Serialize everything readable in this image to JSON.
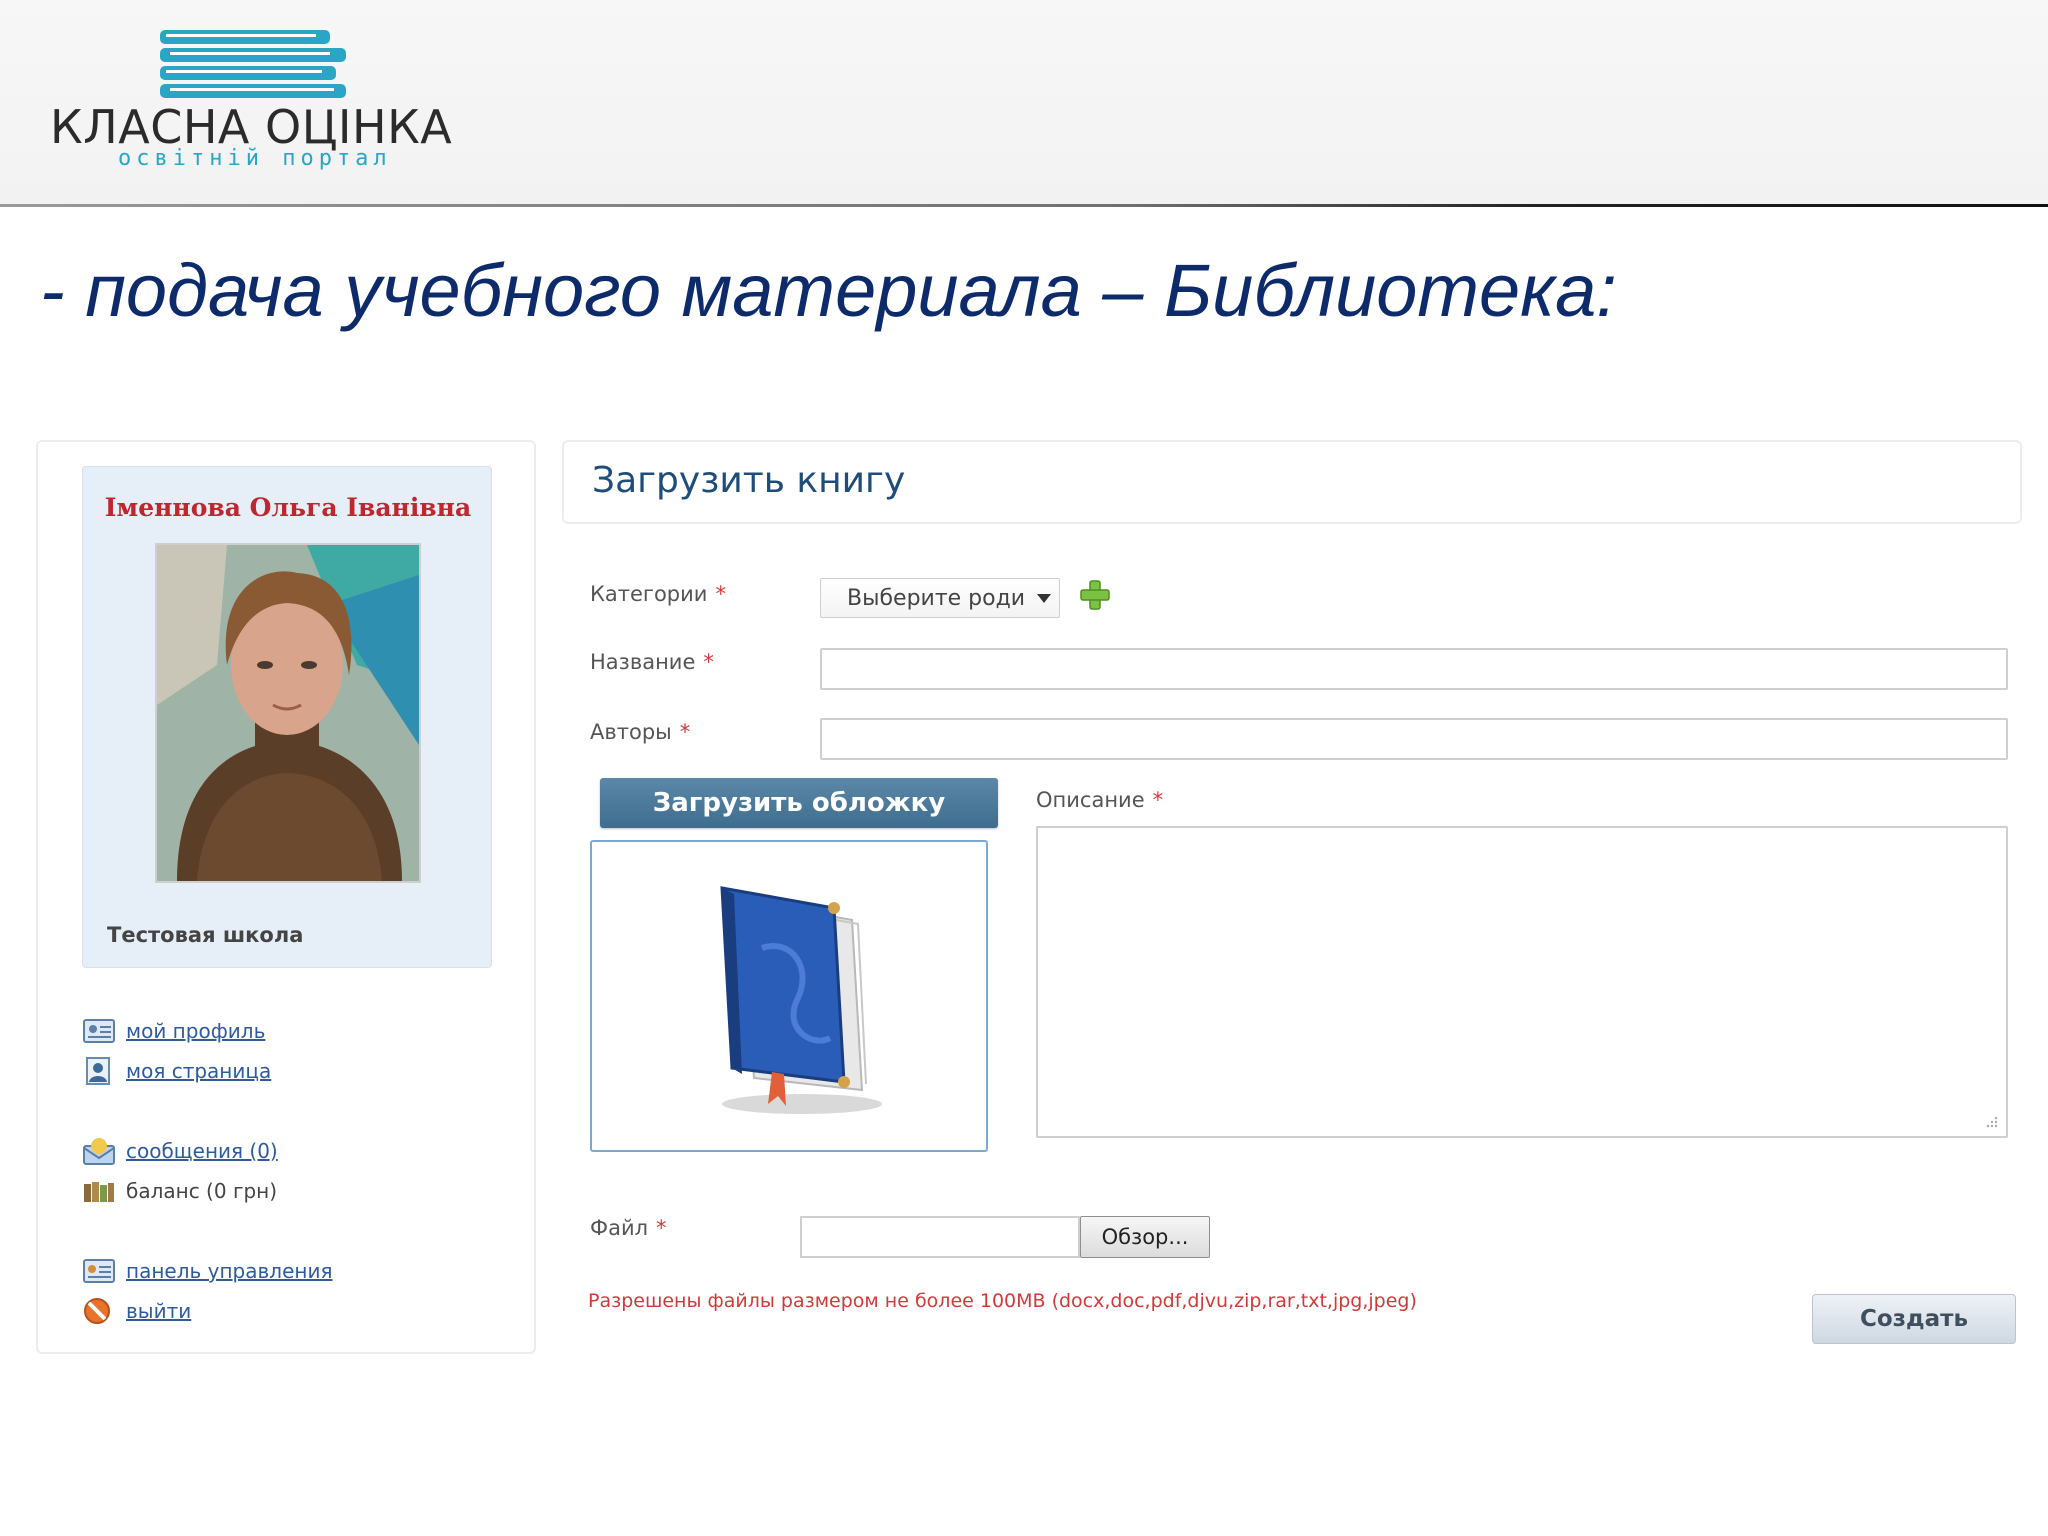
{
  "logo": {
    "title": "КЛАСНА ОЦІНКА",
    "subtitle": "освітній портал",
    "color": "#2aa5c6"
  },
  "slide": {
    "title": "- подача учебного материала – Библиотека:"
  },
  "profile": {
    "name": "Іменнова Ольга Іванівна",
    "school": "Тестовая школа"
  },
  "menu": {
    "items": [
      {
        "label": "мой профиль",
        "icon": "profile-card-icon"
      },
      {
        "label": "моя страница",
        "icon": "user-page-icon"
      },
      {
        "label": "сообщения (0)",
        "icon": "messages-icon"
      },
      {
        "label": "баланс (0 грн)",
        "icon": "balance-icon"
      },
      {
        "label": "панель управления",
        "icon": "control-panel-icon"
      },
      {
        "label": "выйти",
        "icon": "logout-icon"
      }
    ]
  },
  "form": {
    "title": "Загрузить книгу",
    "required_mark": "*",
    "categories_label": "Категории",
    "categories_value": "Выберите роди",
    "name_label": "Название",
    "name_value": "",
    "authors_label": "Авторы",
    "authors_value": "",
    "upload_cover_label": "Загрузить обложку",
    "description_label": "Описание",
    "description_value": "",
    "file_label": "Файл",
    "file_value": "",
    "browse_label": "Обзор...",
    "file_note": "Разрешены файлы размером не более 100MB (docx,doc,pdf,djvu,zip,rar,txt,jpg,jpeg)",
    "create_label": "Создать"
  },
  "colors": {
    "title_blue": "#0d2b6b",
    "name_red": "#c0262d",
    "link_blue": "#2f5b9a",
    "button_blue": "#3f6d8f",
    "required_red": "#d23a3a"
  }
}
